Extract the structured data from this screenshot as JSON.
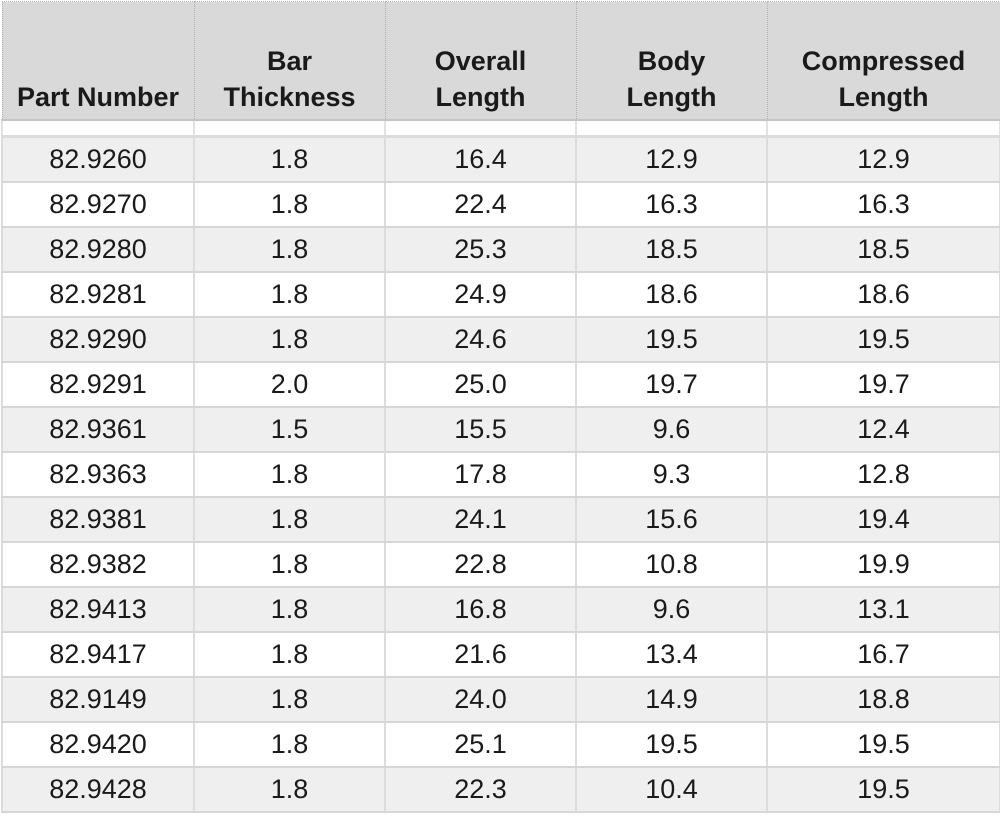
{
  "table": {
    "headers": [
      [
        "Part Number"
      ],
      [
        "Bar",
        "Thickness"
      ],
      [
        "Overall",
        "Length"
      ],
      [
        "Body",
        "Length"
      ],
      [
        "Compressed",
        "Length"
      ]
    ],
    "rows": [
      [
        "82.9260",
        "1.8",
        "16.4",
        "12.9",
        "12.9"
      ],
      [
        "82.9270",
        "1.8",
        "22.4",
        "16.3",
        "16.3"
      ],
      [
        "82.9280",
        "1.8",
        "25.3",
        "18.5",
        "18.5"
      ],
      [
        "82.9281",
        "1.8",
        "24.9",
        "18.6",
        "18.6"
      ],
      [
        "82.9290",
        "1.8",
        "24.6",
        "19.5",
        "19.5"
      ],
      [
        "82.9291",
        "2.0",
        "25.0",
        "19.7",
        "19.7"
      ],
      [
        "82.9361",
        "1.5",
        "15.5",
        "9.6",
        "12.4"
      ],
      [
        "82.9363",
        "1.8",
        "17.8",
        "9.3",
        "12.8"
      ],
      [
        "82.9381",
        "1.8",
        "24.1",
        "15.6",
        "19.4"
      ],
      [
        "82.9382",
        "1.8",
        "22.8",
        "10.8",
        "19.9"
      ],
      [
        "82.9413",
        "1.8",
        "16.8",
        "9.6",
        "13.1"
      ],
      [
        "82.9417",
        "1.8",
        "21.6",
        "13.4",
        "16.7"
      ],
      [
        "82.9149",
        "1.8",
        "24.0",
        "14.9",
        "18.8"
      ],
      [
        "82.9420",
        "1.8",
        "25.1",
        "19.5",
        "19.5"
      ],
      [
        "82.9428",
        "1.8",
        "22.3",
        "10.4",
        "19.5"
      ]
    ]
  },
  "colors": {
    "header_bg": "#d9d9d9",
    "row_alt_bg": "#efefef",
    "row_bg": "#ffffff",
    "grid": "#dcdcdc"
  }
}
